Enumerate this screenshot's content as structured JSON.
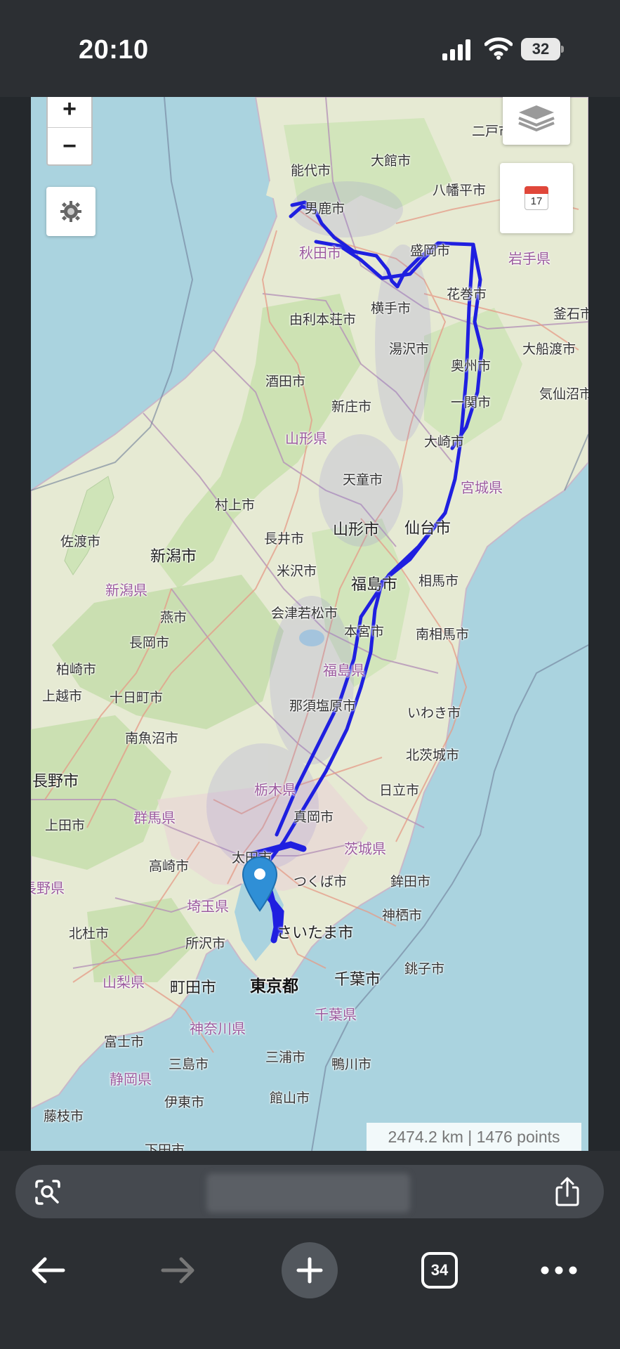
{
  "status_bar": {
    "time": "20:10",
    "battery": "32",
    "icons": [
      "cellular-signal-icon",
      "wifi-icon",
      "battery-icon"
    ]
  },
  "map": {
    "controls": {
      "zoom_in": "+",
      "zoom_out": "−",
      "settings_icon": "gear-icon",
      "layers_icon": "layers-icon",
      "calendar_icon": "calendar-icon",
      "calendar_day": "17"
    },
    "stats": "2474.2 km | 1476 points",
    "track_color": "#1f1fe0",
    "places": {
      "futatsui": "二戸市",
      "noshiro": "能代市",
      "odate": "大館市",
      "hachimantai": "八幡平市",
      "oga": "男鹿市",
      "akita": "秋田市",
      "morioka": "盛岡市",
      "iwate_pref": "岩手県",
      "hanamaki": "花巻市",
      "kamaishi": "釜石市",
      "yokote": "横手市",
      "yurihonjo": "由利本荘市",
      "yuzawa": "湯沢市",
      "ofunato": "大船渡市",
      "oshu": "奥州市",
      "sakata": "酒田市",
      "ichinoseki": "一関市",
      "kesennuma": "気仙沼市",
      "shinjo": "新庄市",
      "yamagata_pref": "山形県",
      "osaki": "大崎市",
      "miyagi_pref": "宮城県",
      "tendo": "天童市",
      "murakami": "村上市",
      "sado": "佐渡市",
      "yamagata": "山形市",
      "sendai": "仙台市",
      "niigata": "新潟市",
      "nagai": "長井市",
      "yonezawa": "米沢市",
      "soma": "相馬市",
      "fukushima": "福島市",
      "niigata_pref": "新潟県",
      "tsubame": "燕市",
      "aizuwakamatsu": "会津若松市",
      "nagaoka": "長岡市",
      "motomiya": "本宮市",
      "minamisoma": "南相馬市",
      "kashiwazaki": "柏崎市",
      "fukushima_pref": "福島県",
      "joetsu": "上越市",
      "tokamachi": "十日町市",
      "nasushiobara": "那須塩原市",
      "iwaki": "いわき市",
      "minamiuonuma": "南魚沼市",
      "kitaibaraki": "北茨城市",
      "nagano": "長野市",
      "tochigi_pref": "栃木県",
      "hitachi": "日立市",
      "gunma_pref": "群馬県",
      "moka": "真岡市",
      "ueda": "上田市",
      "ibaraki_pref": "茨城県",
      "takasaki": "高崎市",
      "ota": "太田市",
      "nagano_pref": "長野県",
      "tsukuba": "つくば市",
      "hokota": "鉾田市",
      "saitama_pref": "埼玉県",
      "kamisu": "神栖市",
      "hokuto": "北杜市",
      "saitama": "さいたま市",
      "tokorozawa": "所沢市",
      "choshi": "銚子市",
      "yamanashi_pref": "山梨県",
      "machida": "町田市",
      "tokyo": "東京都",
      "chiba": "千葉市",
      "kanagawa_pref": "神奈川県",
      "chiba_pref": "千葉県",
      "fuji": "富士市",
      "mishima": "三島市",
      "miura": "三浦市",
      "kamogawa": "鴨川市",
      "shizuoka_pref": "静岡県",
      "ito": "伊東市",
      "tateyama": "館山市",
      "fujieda": "藤枝市",
      "shimoda": "下田市"
    }
  },
  "browser": {
    "lens_icon": "camera-search-icon",
    "share_icon": "share-icon",
    "back_icon": "back-arrow-icon",
    "forward_icon": "forward-arrow-icon",
    "new_tab_icon": "plus-icon",
    "tab_count": "34",
    "more_icon": "more-dots-icon"
  }
}
